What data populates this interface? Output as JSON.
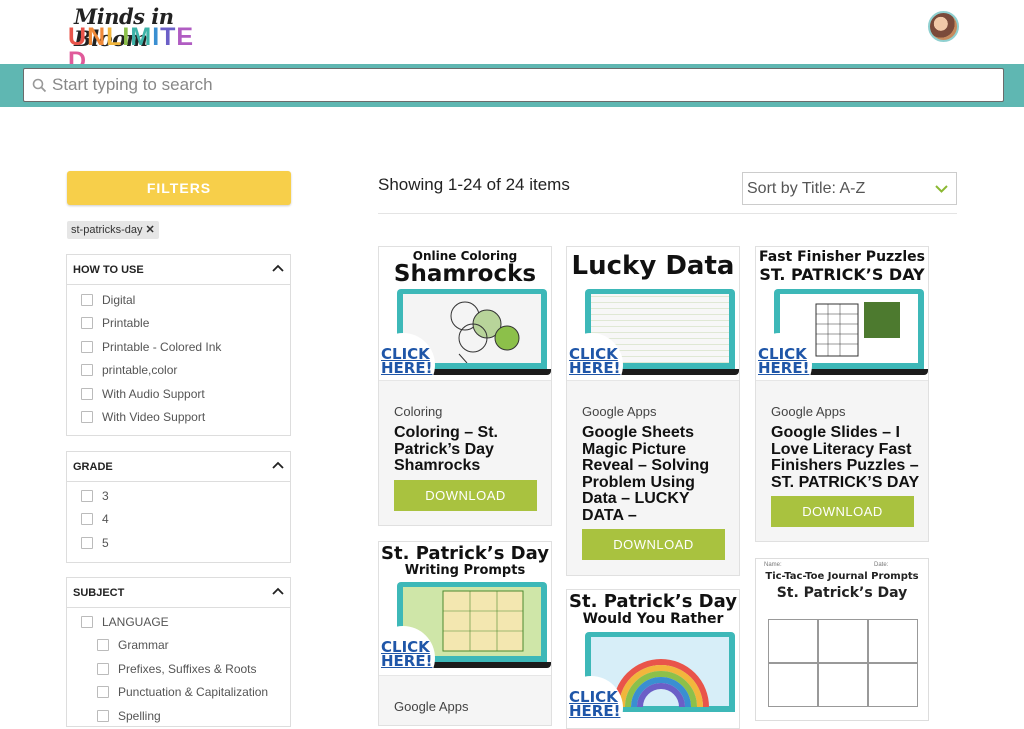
{
  "header": {
    "logo_line1": "Minds in Bloom",
    "logo_line2_letters": [
      "U",
      "N",
      "L",
      "I",
      "M",
      "I",
      "T",
      "E",
      "D"
    ],
    "logo_colors": [
      "#e9544a",
      "#f08a3a",
      "#f2b63c",
      "#8cc04a",
      "#3db3a8",
      "#3a8fd1",
      "#6b5fc7",
      "#b05cc2",
      "#e05a9a"
    ]
  },
  "search": {
    "placeholder": "Start typing to search"
  },
  "filters": {
    "button_label": "FILTERS",
    "active_tag": "st-patricks-day",
    "sections": [
      {
        "title": "HOW TO USE",
        "options": [
          "Digital",
          "Printable",
          "Printable - Colored Ink",
          "printable,color",
          "With Audio Support",
          "With Video Support"
        ]
      },
      {
        "title": "GRADE",
        "options": [
          "3",
          "4",
          "5"
        ]
      },
      {
        "title": "SUBJECT",
        "options": [
          "LANGUAGE"
        ],
        "sub_options": [
          "Grammar",
          "Prefixes, Suffixes & Roots",
          "Punctuation & Capitalization",
          "Spelling"
        ]
      }
    ]
  },
  "results": {
    "showing_text": "Showing 1-24 of 24 items",
    "sort_label": "Sort by Title: A-Z",
    "download_label": "DOWNLOAD",
    "click_here": "CLICK HERE!",
    "cards": [
      {
        "thumb_line1": "Online Coloring",
        "thumb_line2": "Shamrocks",
        "category": "Coloring",
        "title": "Coloring – St. Patrick’s Day Shamrocks"
      },
      {
        "thumb_line1": "",
        "thumb_line2": "Lucky Data",
        "category": "Google Apps",
        "title": "Google Sheets Magic Picture Reveal – Solving Problem Using Data – LUCKY DATA –"
      },
      {
        "thumb_line1": "Fast Finisher Puzzles",
        "thumb_line2": "ST. PATRICK’S DAY",
        "category": "Google Apps",
        "title": "Google Slides – I Love Literacy Fast Finishers Puzzles – ST. PATRICK’S DAY"
      },
      {
        "thumb_line1": "St. Patrick’s Day",
        "thumb_line2": "Writing Prompts",
        "category": "Google Apps",
        "title": ""
      },
      {
        "thumb_line1": "St. Patrick’s Day",
        "thumb_line2": "Would You Rather",
        "category": "",
        "title": ""
      },
      {
        "thumb_line1": "Tic-Tac-Toe Journal Prompts",
        "thumb_line2": "St. Patrick’s Day",
        "name_label": "Name:",
        "date_label": "Date:"
      }
    ]
  }
}
